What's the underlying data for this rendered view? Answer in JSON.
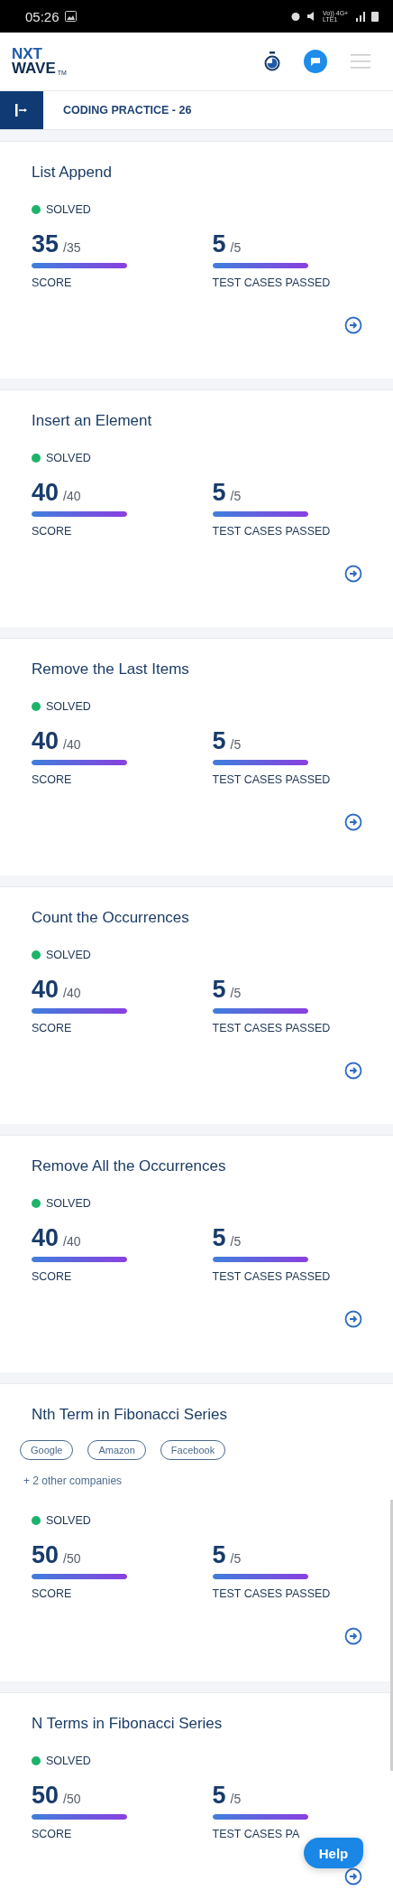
{
  "status_bar": {
    "time": "05:26",
    "network": "Vo)) 4G+ LTE1"
  },
  "header": {
    "logo_top": "NXT",
    "logo_bottom": "WAVE",
    "logo_mark": "TM"
  },
  "sub_bar": {
    "title": "CODING PRACTICE - 26"
  },
  "problems": [
    {
      "title": "List Append",
      "status": {
        "label": "SOLVED",
        "color": "#1db36b"
      },
      "score": {
        "value": "35",
        "max": "/35",
        "level": 1,
        "label": "SCORE"
      },
      "tests": {
        "value": "5",
        "max": "/5",
        "level": 1,
        "label": "TEST CASES PASSED"
      }
    },
    {
      "title": "Insert an Element",
      "status": {
        "label": "SOLVED",
        "color": "#1db36b"
      },
      "score": {
        "value": "40",
        "max": "/40",
        "level": 1,
        "label": "SCORE"
      },
      "tests": {
        "value": "5",
        "max": "/5",
        "level": 1,
        "label": "TEST CASES PASSED"
      }
    },
    {
      "title": "Remove the Last Items",
      "status": {
        "label": "SOLVED",
        "color": "#1db36b"
      },
      "score": {
        "value": "40",
        "max": "/40",
        "level": 1,
        "label": "SCORE"
      },
      "tests": {
        "value": "5",
        "max": "/5",
        "level": 1,
        "label": "TEST CASES PASSED"
      }
    },
    {
      "title": "Count the Occurrences",
      "status": {
        "label": "SOLVED",
        "color": "#1db36b"
      },
      "score": {
        "value": "40",
        "max": "/40",
        "level": 1,
        "label": "SCORE"
      },
      "tests": {
        "value": "5",
        "max": "/5",
        "level": 1,
        "label": "TEST CASES PASSED"
      }
    },
    {
      "title": "Remove All the Occurrences",
      "status": {
        "label": "SOLVED",
        "color": "#1db36b"
      },
      "score": {
        "value": "40",
        "max": "/40",
        "level": 1,
        "label": "SCORE"
      },
      "tests": {
        "value": "5",
        "max": "/5",
        "level": 1,
        "label": "TEST CASES PASSED"
      }
    },
    {
      "title": "Nth Term in Fibonacci Series",
      "companies": [
        "Google",
        "Amazon",
        "Facebook"
      ],
      "more_companies": "+ 2 other companies",
      "status": {
        "label": "SOLVED",
        "color": "#1db36b"
      },
      "score": {
        "value": "50",
        "max": "/50",
        "level": 1,
        "label": "SCORE"
      },
      "tests": {
        "value": "5",
        "max": "/5",
        "level": 1,
        "label": "TEST CASES PASSED"
      }
    },
    {
      "title": "N Terms in Fibonacci Series",
      "status": {
        "label": "SOLVED",
        "color": "#1db36b"
      },
      "score": {
        "value": "50",
        "max": "/50",
        "level": 1,
        "label": "SCORE"
      },
      "tests": {
        "value": "5",
        "max": "/5",
        "level": 1,
        "label": "TEST CASES PA"
      }
    }
  ],
  "help_button": {
    "label": "Help"
  }
}
